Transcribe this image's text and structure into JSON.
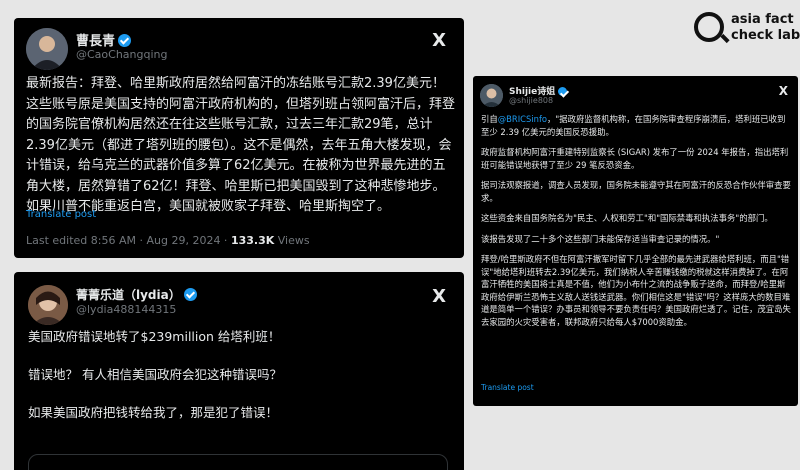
{
  "logo": {
    "line1": "asia fact",
    "line2": "check lab"
  },
  "card1": {
    "name": "曹長青",
    "handle": "@CaoChangqing",
    "text": "最新报告：拜登、哈里斯政府居然给阿富汗的冻结账号汇款2.39亿美元！这些账号原是美国支持的阿富汗政府机构的，但塔列班占领阿富汗后，拜登的国务院官僚机构居然还在往这些账号汇款，过去三年汇款29笔，总计2.39亿美元（都进了塔列班的腰包）。这不是偶然，去年五角大楼发现，会计错误，给乌克兰的武器价值多算了62亿美元。在被称为世界最先进的五角大楼，居然算错了62亿！拜登、哈里斯已把美国毁到了这种悲惨地步。如果川普不能重返白宫，美国就被败家子拜登、哈里斯掏空了。",
    "translate": "Translate post",
    "meta_prefix": "Last edited 8:56 AM · Aug 29, 2024 · ",
    "views_count": "133.3K",
    "views_label": " Views"
  },
  "card2": {
    "name": "菁菁乐道（lydia）",
    "handle": "@lydia488144315",
    "para1": "美国政府错误地转了$239million 给塔利班！",
    "para2": "错误地？ 有人相信美国政府会犯这种错误吗？",
    "para3": "如果美国政府把钱转给我了，那是犯了错误！"
  },
  "card3": {
    "name": "Shijie诗姐",
    "handle": "@shijie808",
    "p1_prefix": "引自",
    "p1_link": "@BRICSinfo",
    "p1_rest": "，\"据政府监督机构称，在国务院审查程序崩溃后，塔利班已收到至少 2.39 亿美元的美国反恐援助。",
    "p2": "政府监督机构阿富汗重建特别监察长 (SIGAR) 发布了一份 2024 年报告，指出塔利班可能错误地获得了至少 29 笔反恐资金。",
    "p3": "据司法观察报道，调查人员发现，国务院未能遵守其在阿富汗的反恐合作伙伴审查要求。",
    "p4": "这些资金来自国务院名为\"民主、人权和劳工\"和\"国际禁毒和执法事务\"的部门。",
    "p5": "该报告发现了二十多个这些部门未能保存适当审查记录的情况。\"",
    "p6": "拜登/哈里斯政府不但在阿富汗撤军时留下几乎全部的最先进武器给塔利班，而且\"错误\"地给塔利班转去2.39亿美元，我们纳税人辛苦赚钱缴的税就这样消费掉了。在阿富汗牺牲的美国将士真是不值，他们为小布什之流的战争贩子送命，而拜登/哈里斯政府给伊斯兰恐怖主义敌人送钱送武器。你们相信这是\"错误\"吗？这样庞大的数目难道是简单一个错误？办事员和领导不要负责任吗？美国政府烂透了。记住，茂宜岛失去家园的火灾受害者，联邦政府只给每人$7000资助金。",
    "translate": "Translate post"
  },
  "icons": {
    "x": "X"
  }
}
